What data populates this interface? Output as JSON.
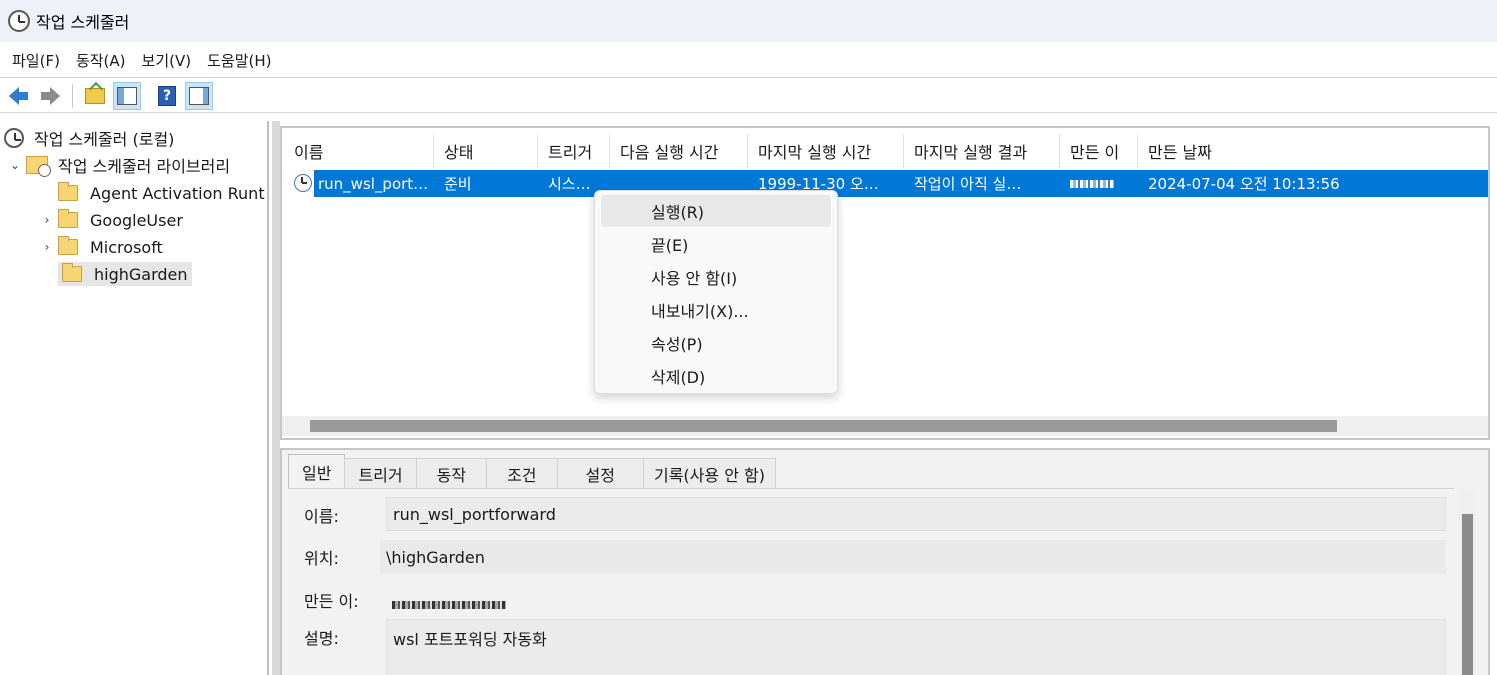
{
  "window": {
    "title": "작업 스케줄러"
  },
  "menu": {
    "items": [
      "파일(F)",
      "동작(A)",
      "보기(V)",
      "도움말(H)"
    ]
  },
  "toolbar": {
    "buttons": [
      "back-icon",
      "forward-icon",
      "up-folder-icon",
      "show-hide-console-tree-icon",
      "help-icon",
      "show-hide-action-pane-icon"
    ]
  },
  "tree": {
    "root": "작업 스케줄러 (로컬)",
    "library": "작업 스케줄러 라이브러리",
    "items": [
      "Agent Activation Runt",
      "GoogleUser",
      "Microsoft",
      "highGarden"
    ]
  },
  "list": {
    "columns": [
      "이름",
      "상태",
      "트리거",
      "다음 실행 시간",
      "마지막 실행 시간",
      "마지막 실행 결과",
      "만든 이",
      "만든 날짜"
    ],
    "rows": [
      {
        "name": "run_wsl_port…",
        "status": "준비",
        "trigger": "시스…",
        "next_run": "",
        "last_run": "1999-11-30 오…",
        "last_result": "작업이 아직 실…",
        "author": "",
        "created": "2024-07-04 오전 10:13:56"
      }
    ]
  },
  "context_menu": {
    "items": [
      "실행(R)",
      "끝(E)",
      "사용 안 함(I)",
      "내보내기(X)...",
      "속성(P)",
      "삭제(D)"
    ]
  },
  "detail": {
    "tabs": [
      "일반",
      "트리거",
      "동작",
      "조건",
      "설정",
      "기록(사용 안 함)"
    ],
    "name_label": "이름:",
    "name_value": "run_wsl_portforward",
    "location_label": "위치:",
    "location_value": "\\highGarden",
    "author_label": "만든 이:",
    "desc_label": "설명:",
    "desc_value": "wsl 포트포워딩 자동화"
  }
}
